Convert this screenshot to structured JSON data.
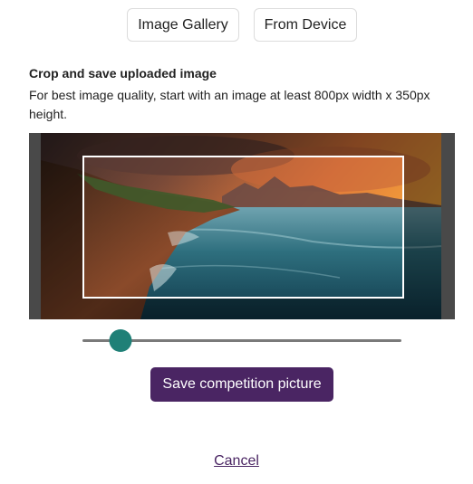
{
  "source_buttons": {
    "gallery_label": "Image Gallery",
    "device_label": "From Device"
  },
  "crop": {
    "title": "Crop and save uploaded image",
    "help_text": "For best image quality, start with an image at least 800px width x 350px height."
  },
  "zoom": {
    "level": 0.12
  },
  "actions": {
    "save_label": "Save competition picture",
    "cancel_label": "Cancel"
  },
  "colors": {
    "primary": "#4a2563",
    "slider_thumb": "#1f8077",
    "crop_backdrop": "#7f7f7f"
  }
}
